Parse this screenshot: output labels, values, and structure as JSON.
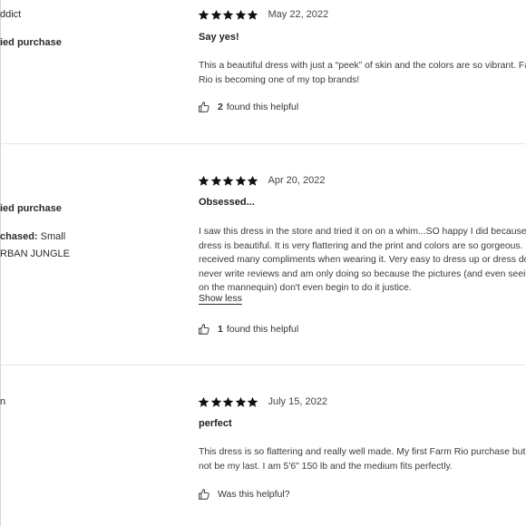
{
  "reviews": [
    {
      "sidebar": {
        "line1": "ddict",
        "line2": "ied purchase"
      },
      "rating": 5,
      "date": "May 22, 2022",
      "title": "Say yes!",
      "body": [
        "This a beautiful dress with just a “peek” of skin and the colors are so vibrant. Farm",
        "Rio is becoming one of my top brands!"
      ],
      "helpful_count": "2",
      "helpful_label": "found this helpful"
    },
    {
      "sidebar": {
        "line1": "ied purchase",
        "size_label": "chased:",
        "size_value": "Small",
        "color": "RBAN JUNGLE"
      },
      "rating": 5,
      "date": "Apr 20, 2022",
      "title": "Obsessed...",
      "body": [
        "I saw this dress in the store and tried it on on a whim...SO happy I did because the",
        "dress is beautiful. It is very flattering and the print and colors are so gorgeous. I",
        "received many compliments when wearing it. Very easy to dress up or dress down.",
        "never write reviews and am only doing so because the pictures (and even seeing",
        "on the mannequin) don't even begin to do it justice."
      ],
      "show_less": "Show less",
      "helpful_count": "1",
      "helpful_label": "found this helpful"
    },
    {
      "sidebar": {
        "line1": "n"
      },
      "rating": 5,
      "date": "July 15, 2022",
      "title": "perfect",
      "body": [
        "This dress is so flattering and really well made. My first Farm Rio purchase but will",
        "not be my last. I am 5'6\" 150 lb and the medium fits perfectly."
      ],
      "helpful_label": "Was this helpful?"
    }
  ]
}
